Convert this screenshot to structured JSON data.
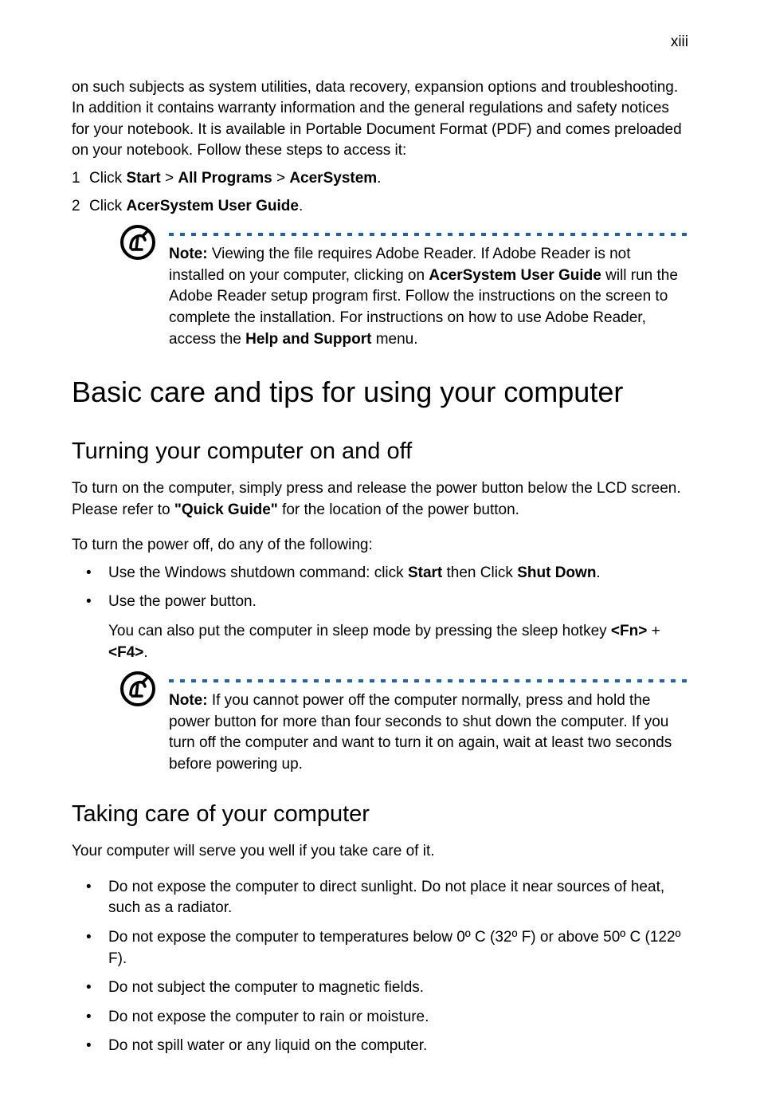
{
  "page_number": "xiii",
  "intro_paragraph": "on such subjects as system utilities, data recovery, expansion options and troubleshooting. In addition it contains warranty information and the general regulations and safety notices for your notebook. It is available in Portable Document Format (PDF) and comes preloaded on your notebook. Follow these steps to access it:",
  "step1": {
    "num": "1",
    "pre": "Click ",
    "b1": "Start",
    "mid1": " > ",
    "b2": "All Programs",
    "mid2": " > ",
    "b3": "AcerSystem",
    "end": "."
  },
  "step2": {
    "num": "2",
    "pre": "Click ",
    "b1": "AcerSystem User Guide",
    "end": "."
  },
  "note1": {
    "label": "Note:",
    "p1": " Viewing the file requires Adobe Reader. If Adobe Reader is not installed on your computer, clicking on ",
    "b1": "AcerSystem User Guide",
    "p2": " will run the Adobe Reader setup program first. Follow the instructions on the screen to complete the installation. For instructions on how to use Adobe Reader, access the ",
    "b2": "Help and Support",
    "p3": " menu."
  },
  "h1": "Basic care and tips for using your computer",
  "h2a": "Turning your computer on and off",
  "para_turn_on_pre": "To turn on the computer, simply press and release the power button below the LCD screen. Please refer to ",
  "para_turn_on_bold": "\"Quick Guide\"",
  "para_turn_on_post": " for the location of the power button.",
  "para_turn_off": "To turn the power off, do any of the following:",
  "bullet_a1_pre": "Use the Windows shutdown command: click ",
  "bullet_a1_b1": "Start",
  "bullet_a1_mid": " then Click ",
  "bullet_a1_b2": "Shut Down",
  "bullet_a1_end": ".",
  "bullet_a2": "Use the power button.",
  "sub_para_pre": "You can also put the computer in sleep mode by pressing the sleep hotkey ",
  "sub_para_b1": "<Fn>",
  "sub_para_mid": " + ",
  "sub_para_b2": "<F4>",
  "sub_para_end": ".",
  "note2": {
    "label": "Note:",
    "text": " If you cannot power off the computer normally, press and hold the power button for more than four seconds to shut down the computer. If you turn off the computer and want to turn it on again, wait at least two seconds before powering up."
  },
  "h2b": "Taking care of your computer",
  "para_care": "Your computer will serve you well if you take care of it.",
  "bullet_b1": "Do not expose the computer to direct sunlight. Do not place it near sources of heat, such as a radiator.",
  "bullet_b2": "Do not expose the computer to temperatures below 0º C (32º F) or above 50º C (122º F).",
  "bullet_b3": "Do not subject the computer to magnetic fields.",
  "bullet_b4": "Do not expose the computer to rain or moisture.",
  "bullet_b5": "Do not spill water or any liquid on the computer."
}
